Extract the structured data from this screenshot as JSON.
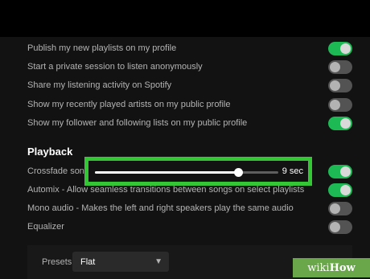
{
  "social": {
    "items": [
      {
        "label": "Publish my new playlists on my profile",
        "on": true
      },
      {
        "label": "Start a private session to listen anonymously",
        "on": false
      },
      {
        "label": "Share my listening activity on Spotify",
        "on": false
      },
      {
        "label": "Show my recently played artists on my public profile",
        "on": false
      },
      {
        "label": "Show my follower and following lists on my public profile",
        "on": true
      }
    ]
  },
  "playback": {
    "title": "Playback",
    "crossfade": {
      "label": "Crossfade songs",
      "value_text": "9 sec",
      "level_fraction": 0.78,
      "on": true
    },
    "items": [
      {
        "label": "Automix - Allow seamless transitions between songs on select playlists",
        "on": true
      },
      {
        "label": "Mono audio - Makes the left and right speakers play the same audio",
        "on": false
      },
      {
        "label": "Equalizer",
        "on": false
      }
    ]
  },
  "presets": {
    "label": "Presets",
    "value": "Flat"
  },
  "watermark": {
    "part1": "wiki",
    "part2": "How"
  },
  "colors": {
    "accent_green": "#1db954",
    "highlight_border": "#35c635",
    "background": "#121212"
  },
  "icons": {
    "dropdown": "chevron-down-icon"
  }
}
